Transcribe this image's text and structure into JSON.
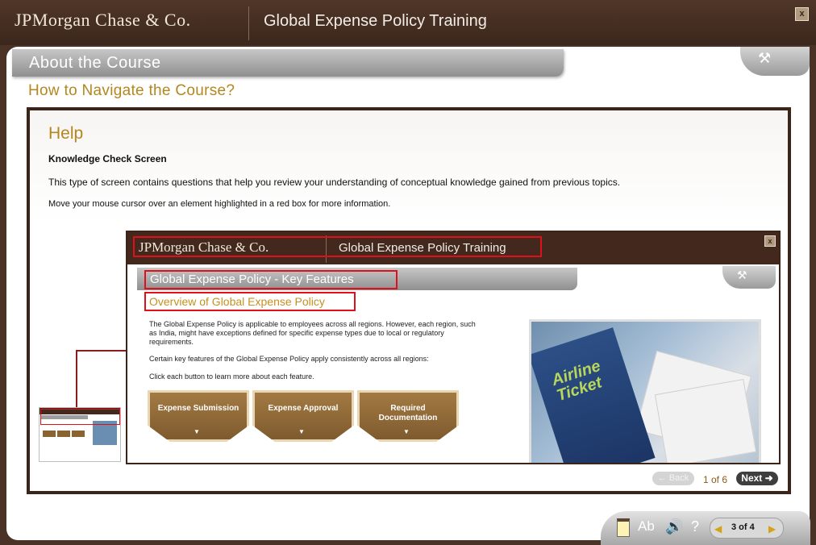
{
  "header": {
    "brand": "JPMorgan Chase & Co.",
    "app_title": "Global Expense Policy Training",
    "close_label": "x"
  },
  "section": {
    "tab_title": "About the Course",
    "sub_heading": "How to Navigate the Course?"
  },
  "help": {
    "title": "Help",
    "screen_name": "Knowledge Check Screen",
    "description": "This type of screen contains questions that help you review your understanding of conceptual knowledge gained from previous topics.",
    "hint": "Move your mouse cursor over an element highlighted in a red box for more information."
  },
  "inner_screen": {
    "brand": "JPMorgan Chase & Co.",
    "app_title": "Global Expense Policy Training",
    "close_label": "x",
    "tab_title": "Global Expense Policy - Key Features",
    "sub_heading": "Overview of Global Expense Policy",
    "para1": "The Global Expense Policy is applicable to employees across all regions. However, each region, such as India, might have exceptions defined for specific expense types due to local or regulatory requirements.",
    "para2": "Certain key features of the Global Expense Policy apply consistently across all regions:",
    "para3": "Click each button to learn more about each feature.",
    "buttons": [
      "Expense Submission",
      "Expense Approval",
      "Required Documentation"
    ],
    "image_text": "Airline Ticket"
  },
  "pagination": {
    "back_label": "Back",
    "page_text": "1 of 6",
    "next_label": "Next"
  },
  "bottom_nav": {
    "text_size_label": "Ab",
    "help_label": "?",
    "page_indicator": "3 of 4"
  },
  "colors": {
    "header_brown": "#43291d",
    "gold_heading": "#b4861e",
    "highlight_red": "#e0101a"
  }
}
